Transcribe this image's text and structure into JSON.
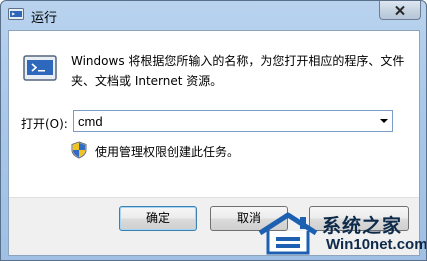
{
  "window": {
    "title": "运行",
    "close_glyph": "✕"
  },
  "dialog": {
    "description": "Windows 将根据您所输入的名称，为您打开相应的程序、文件夹、文档或 Internet 资源。",
    "open_label": "打开(O):",
    "command_value": "cmd",
    "admin_note": "使用管理权限创建此任务。"
  },
  "buttons": {
    "ok": "确定",
    "cancel": "取消",
    "browse": ""
  },
  "watermark": {
    "line1": "系统之家",
    "line2": "Win10net.com"
  },
  "icons": {
    "title": "run-icon",
    "main": "run-icon",
    "shield": "uac-shield-icon",
    "dropdown": "chevron-down-icon"
  }
}
